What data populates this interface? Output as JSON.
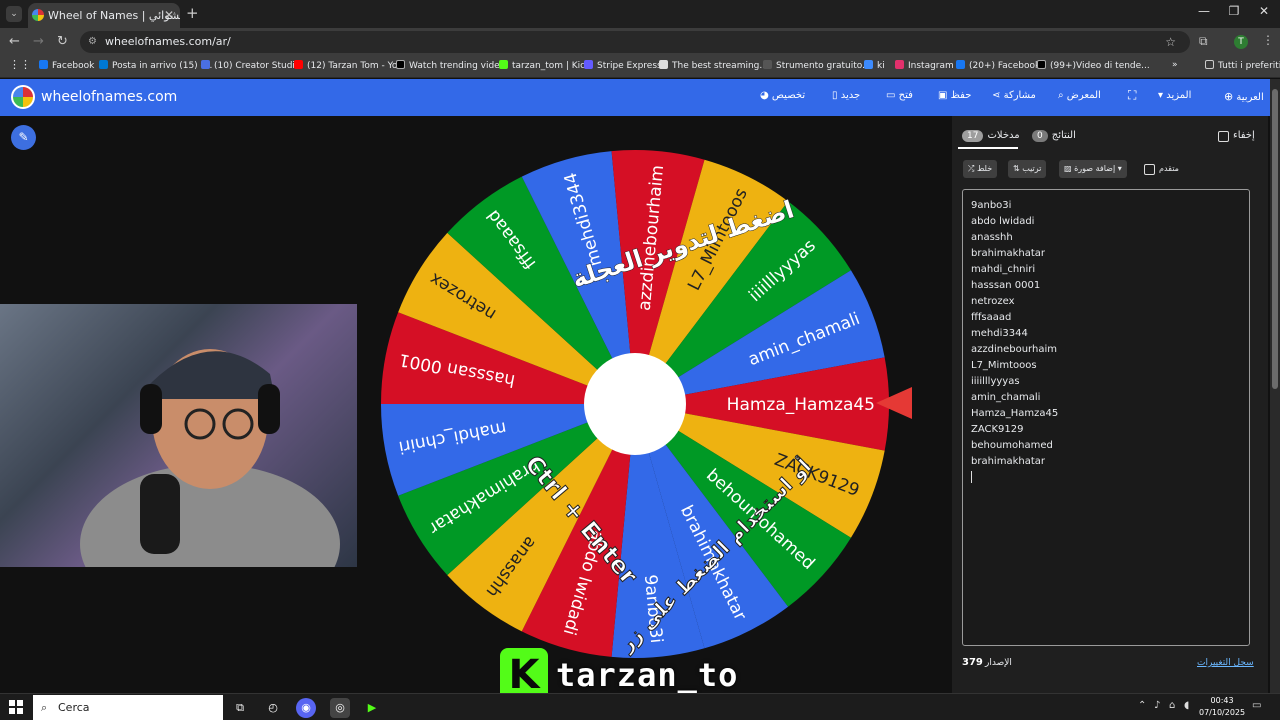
{
  "browser": {
    "tab_title": "Wheel of Names | ‏اسم العشوائي",
    "url": "wheelofnames.com/ar/",
    "bookmarks": [
      "Facebook",
      "Posta in arrivo (15) -...",
      "(10) Creator Studio",
      "(12) Tarzan Tom - Yo...",
      "Watch trending vide...",
      "tarzan_tom | Kick",
      "Stripe Express",
      "The best streaming...",
      "Strumento gratuito...",
      "ki",
      "Instagram",
      "(20+) Facebook",
      "(99+)Video di tende...",
      "Tutti i preferiti"
    ],
    "profile_initial": "T"
  },
  "site": {
    "title": "wheelofnames.com",
    "menu": {
      "language": "العربية",
      "more": "المزيد",
      "gallery": "المعرض",
      "share": "مشاركة",
      "save": "حفظ",
      "open": "فتح",
      "new": "جديد",
      "customize": "تخصيص"
    }
  },
  "wheel": {
    "overlay_top": "اضغط لتدوير العجلة",
    "overlay_bottom": "أو استخدام الضغط على زر",
    "overlay_keys": "Ctrl + Enter",
    "colors": [
      "#3369e8",
      "#d50f25",
      "#eeb211",
      "#009925"
    ]
  },
  "sidebar": {
    "hide_label": "إخفاء",
    "tab_results": "النتائج",
    "tab_results_count": "0",
    "tab_entries": "مدخلات",
    "tab_entries_count": "17",
    "shuffle": "خلط",
    "sort": "ترتيب",
    "add_image": "إضافة صورة",
    "advanced": "متقدم",
    "entries": [
      "9anbo3i",
      "abdo lwidadi",
      "anasshh",
      "brahimakhatar",
      "mahdi_chniri",
      "hasssan 0001",
      "netrozex",
      "fffsaaad",
      "mehdi3344",
      "azzdinebourhaim",
      "L7_Mimtooos",
      "iiiilllyyyas",
      "amin_chamali",
      "Hamza_Hamza45",
      "ZACK9129",
      "behoumohamed",
      "brahimakhatar"
    ],
    "version_label": "الإصدار",
    "version_number": "379",
    "changelog": "سجل التغييرات"
  },
  "stream": {
    "channel": "tarzan_to"
  },
  "taskbar": {
    "search_placeholder": "Cerca",
    "time": "00:43",
    "date": "07/10/2025"
  }
}
